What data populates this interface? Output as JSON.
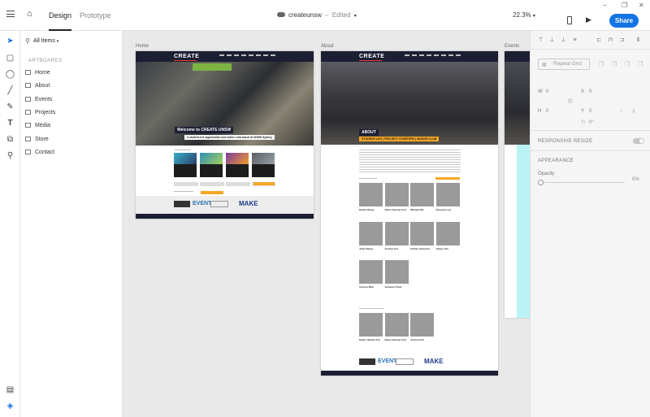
{
  "topbar": {
    "tab_design": "Design",
    "tab_prototype": "Prototype",
    "doc_name": "createunsw",
    "doc_status": "Edited",
    "zoom": "22.3%",
    "share": "Share"
  },
  "layers": {
    "filter": "All Items",
    "section": "ARTBOARDS",
    "items": [
      "Home",
      "About",
      "Events",
      "Projects",
      "Media",
      "Store",
      "Contact"
    ]
  },
  "canvas": {
    "artboards": [
      "Home",
      "About",
      "Events"
    ],
    "home": {
      "logo": "CREATE",
      "hero_title": "Welcome to CREATE UNSW",
      "hero_sub": "A student-led organisation and maker club based at UNSW Sydney"
    },
    "about": {
      "logo": "CREATE",
      "heading": "ABOUT",
      "banner": "STUDENT-LED | PROJECT STARTERS | MAKER CLUB",
      "team": [
        [
          "Daniel Wong",
          "Dylan Samuel Goh",
          "Michael Wu",
          "Rosanna Lee"
        ],
        [
          "Junji Sheng",
          "Joshua Soo",
          "Farhan Sumantri",
          "Taiyue Tan"
        ],
        [
          "Vincent Wail",
          "Johanna Thew"
        ]
      ],
      "team2": [
        "Dylan Yikwah Goh",
        "Dylan Samuel Goh",
        "Joshua Soh"
      ]
    }
  },
  "props": {
    "repeat_grid": "Repeat Grid",
    "w_label": "W",
    "w_val": "0",
    "h_label": "H",
    "h_val": "0",
    "x_label": "X",
    "x_val": "0",
    "y_label": "Y",
    "y_val": "0",
    "rot_val": "0°",
    "responsive": "RESPONSIVE RESIZE",
    "appearance": "APPEARANCE",
    "opacity_label": "Opacity",
    "opacity_val": "0%"
  },
  "colors": {
    "accent": "#1473e6",
    "nav": "#1c1f33",
    "highlight": "#f5a623",
    "cyan": "#b9f3f5"
  }
}
